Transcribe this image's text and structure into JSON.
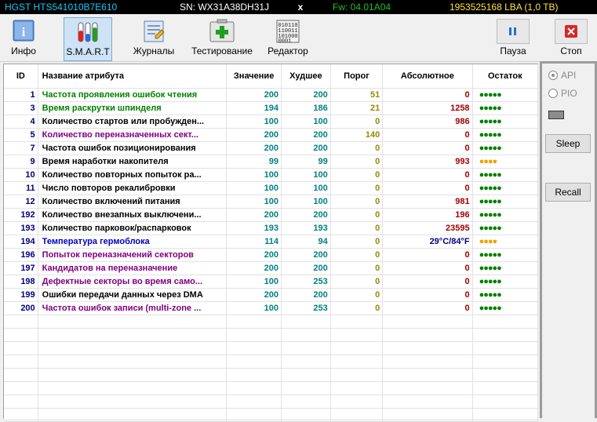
{
  "topbar": {
    "model": "HGST HTS541010B7E610",
    "serial": "SN: WX31A38DH31J",
    "close_glyph": "x",
    "firmware": "Fw: 04.01A04",
    "capacity": "1953525168 LBA (1,0 TB)"
  },
  "toolbar": {
    "info": "Инфо",
    "smart": "S.M.A.R.T",
    "logs": "Журналы",
    "testing": "Тестирование",
    "editor": "Редактор",
    "pause": "Пауза",
    "stop": "Стоп"
  },
  "table": {
    "headers": {
      "id": "ID",
      "name": "Название атрибута",
      "value": "Значение",
      "worst": "Худшее",
      "threshold": "Порог",
      "absolute": "Абсолютное",
      "remaining": "Остаток"
    },
    "rows": [
      {
        "id": "1",
        "name": "Частота проявления ошибок чтения",
        "value": "200",
        "worst": "200",
        "threshold": "51",
        "absolute": "0",
        "remaining": "●●●●●",
        "name_color": "#008000",
        "dots_color": "#008000"
      },
      {
        "id": "3",
        "name": "Время раскрутки шпинделя",
        "value": "194",
        "worst": "186",
        "threshold": "21",
        "absolute": "1258",
        "remaining": "●●●●●",
        "name_color": "#008000",
        "dots_color": "#008000"
      },
      {
        "id": "4",
        "name": "Количество стартов или пробужден...",
        "value": "100",
        "worst": "100",
        "threshold": "0",
        "absolute": "986",
        "remaining": "●●●●●",
        "name_color": "#000000",
        "dots_color": "#008000"
      },
      {
        "id": "5",
        "name": "Количество переназначенных сект...",
        "value": "200",
        "worst": "200",
        "threshold": "140",
        "absolute": "0",
        "remaining": "●●●●●",
        "name_color": "#800080",
        "dots_color": "#008000"
      },
      {
        "id": "7",
        "name": "Частота ошибок позиционирования",
        "value": "200",
        "worst": "200",
        "threshold": "0",
        "absolute": "0",
        "remaining": "●●●●●",
        "name_color": "#000000",
        "dots_color": "#008000"
      },
      {
        "id": "9",
        "name": "Время наработки накопителя",
        "value": "99",
        "worst": "99",
        "threshold": "0",
        "absolute": "993",
        "remaining": "●●●●",
        "name_color": "#000000",
        "dots_color": "#f0a000"
      },
      {
        "id": "10",
        "name": "Количество повторных попыток ра...",
        "value": "100",
        "worst": "100",
        "threshold": "0",
        "absolute": "0",
        "remaining": "●●●●●",
        "name_color": "#000000",
        "dots_color": "#008000"
      },
      {
        "id": "11",
        "name": "Число повторов рекалибровки",
        "value": "100",
        "worst": "100",
        "threshold": "0",
        "absolute": "0",
        "remaining": "●●●●●",
        "name_color": "#000000",
        "dots_color": "#008000"
      },
      {
        "id": "12",
        "name": "Количество включений питания",
        "value": "100",
        "worst": "100",
        "threshold": "0",
        "absolute": "981",
        "remaining": "●●●●●",
        "name_color": "#000000",
        "dots_color": "#008000"
      },
      {
        "id": "192",
        "name": "Количество внезапных выключени...",
        "value": "200",
        "worst": "200",
        "threshold": "0",
        "absolute": "196",
        "remaining": "●●●●●",
        "name_color": "#000000",
        "dots_color": "#008000"
      },
      {
        "id": "193",
        "name": "Количество парковок/распарковок",
        "value": "193",
        "worst": "193",
        "threshold": "0",
        "absolute": "23595",
        "remaining": "●●●●●",
        "name_color": "#000000",
        "dots_color": "#008000"
      },
      {
        "id": "194",
        "name": "Температура гермоблока",
        "value": "114",
        "worst": "94",
        "threshold": "0",
        "absolute": "29°C/84°F",
        "remaining": "●●●●",
        "name_color": "#0000c0",
        "dots_color": "#f0a000"
      },
      {
        "id": "196",
        "name": "Попыток переназначений секторов",
        "value": "200",
        "worst": "200",
        "threshold": "0",
        "absolute": "0",
        "remaining": "●●●●●",
        "name_color": "#800080",
        "dots_color": "#008000"
      },
      {
        "id": "197",
        "name": "Кандидатов на переназначение",
        "value": "200",
        "worst": "200",
        "threshold": "0",
        "absolute": "0",
        "remaining": "●●●●●",
        "name_color": "#800080",
        "dots_color": "#008000"
      },
      {
        "id": "198",
        "name": "Дефектные секторы во время само...",
        "value": "100",
        "worst": "253",
        "threshold": "0",
        "absolute": "0",
        "remaining": "●●●●●",
        "name_color": "#800080",
        "dots_color": "#008000"
      },
      {
        "id": "199",
        "name": "Ошибки передачи данных через DMA",
        "value": "200",
        "worst": "200",
        "threshold": "0",
        "absolute": "0",
        "remaining": "●●●●●",
        "name_color": "#000000",
        "dots_color": "#008000"
      },
      {
        "id": "200",
        "name": "Частота ошибок записи (multi-zone ...",
        "value": "100",
        "worst": "253",
        "threshold": "0",
        "absolute": "0",
        "remaining": "●●●●●",
        "name_color": "#800080",
        "dots_color": "#008000"
      }
    ]
  },
  "side": {
    "api": "API",
    "pio": "PIO",
    "sleep": "Sleep",
    "recall": "Recall"
  }
}
